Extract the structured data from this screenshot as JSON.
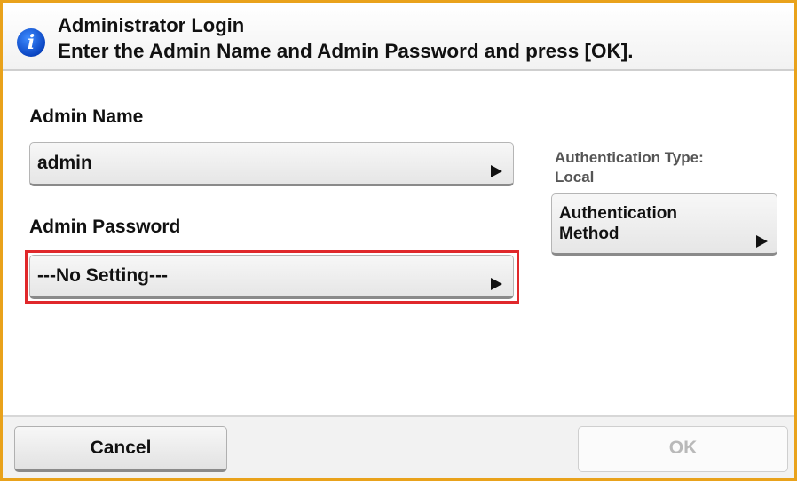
{
  "header": {
    "icon": "info-icon",
    "icon_glyph": "i",
    "title": "Administrator Login",
    "message": "Enter the Admin Name and Admin Password and press [OK]."
  },
  "admin_name": {
    "label": "Admin Name",
    "value": "admin"
  },
  "admin_password": {
    "label": "Admin Password",
    "value": "---No Setting---"
  },
  "authentication": {
    "type_label": "Authentication Type:",
    "type_value": "Local",
    "method_button_line1": "Authentication",
    "method_button_line2": "Method"
  },
  "footer": {
    "cancel_label": "Cancel",
    "ok_label": "OK"
  },
  "colors": {
    "frame_border": "#e9a21b",
    "focus_ring": "#e0282b",
    "info_icon": "#0a45c2",
    "disabled_text": "#b9b9b9"
  }
}
